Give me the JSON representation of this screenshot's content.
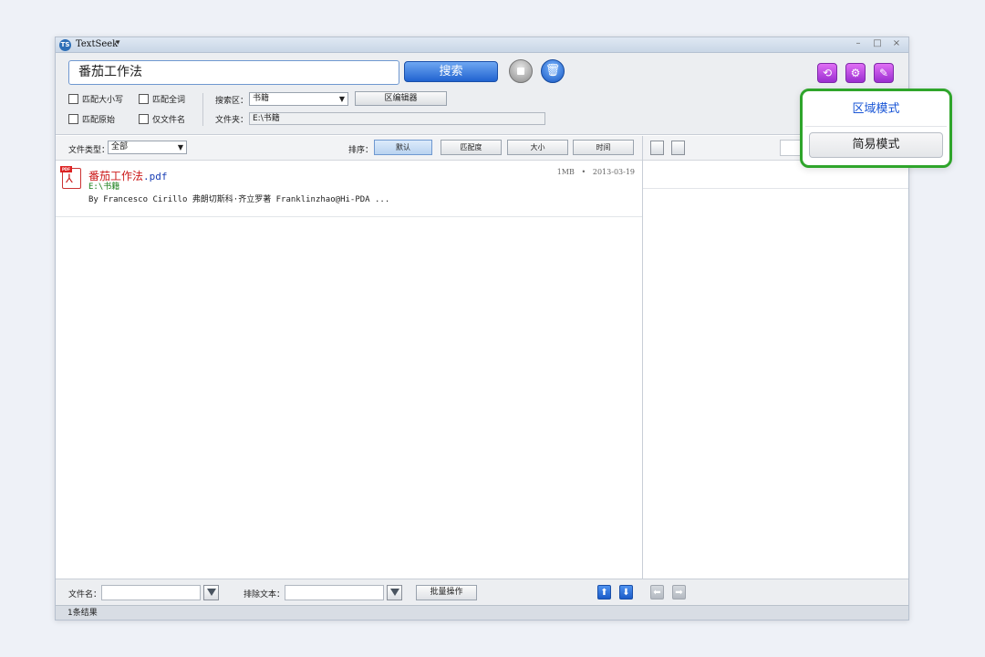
{
  "app": {
    "icon_text": "TS",
    "title": "TextSeek",
    "title_caret": "▾",
    "window_controls": {
      "minimize": "–",
      "maximize": "□",
      "close": "×"
    }
  },
  "search": {
    "query": "番茄工作法",
    "button_label": "搜索",
    "trash_glyph": "🗑"
  },
  "options": {
    "match_case": "匹配大小写",
    "match_whole_word": "匹配全词",
    "match_original": "匹配原始",
    "filename_only": "仅文件名",
    "search_area_label": "搜索区：",
    "search_area_value": "书籍",
    "area_editor_button": "区编辑器",
    "folder_label": "文件夹：",
    "folder_value": "E:\\书籍"
  },
  "tools": {
    "icon1": "⟲",
    "icon2": "⚙",
    "icon3": "✎"
  },
  "filter": {
    "file_type_label": "文件类型：",
    "file_type_value": "全部",
    "sort_label": "排序：",
    "sort_options": [
      "默认",
      "匹配度",
      "大小",
      "时间"
    ]
  },
  "results": [
    {
      "name": "番茄工作法",
      "ext": ".pdf",
      "path": "E:\\书籍",
      "snippet": "By Francesco Cirillo 弗朗切斯科·齐立罗著 Franklinzhao@Hi-PDA ...",
      "size": "1MB",
      "date": "2013-03-19",
      "icon_tag": "PDF",
      "icon_symbol": "⅄"
    }
  ],
  "bottom": {
    "filename_label": "文件名：",
    "exclude_label": "排除文本：",
    "batch_button": "批量操作",
    "up_arrow": "⬆",
    "down_arrow": "⬇",
    "back_arrow": "⬅",
    "forward_arrow": "➡"
  },
  "status": {
    "result_count": "1条结果"
  },
  "mode_popup": {
    "region_mode": "区域模式",
    "simple_mode": "简易模式"
  },
  "colors": {
    "popup_border": "#2fa52b",
    "search_button": "#2163d0",
    "filename": "#cc1a1a",
    "path": "#1a7f1a",
    "tool_icons": "#9a2ed0"
  }
}
